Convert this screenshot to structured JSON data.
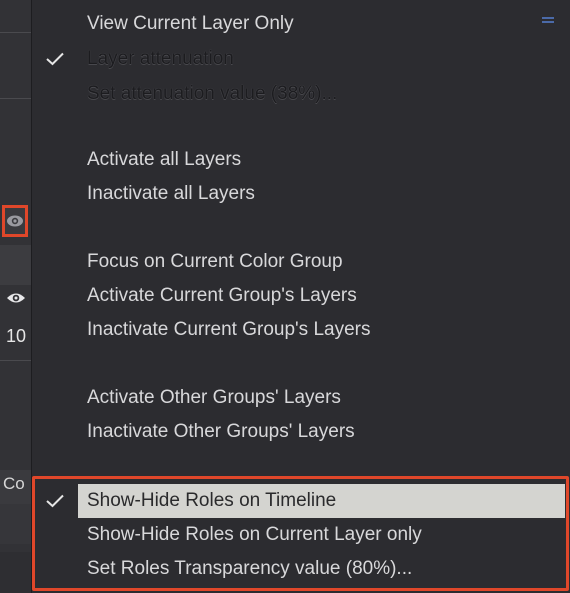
{
  "left_panel": {
    "number_text": "10",
    "co_text": "Co"
  },
  "menu": {
    "items": [
      {
        "label": "View Current Layer Only",
        "checked": false,
        "enabled": true
      },
      {
        "label": "Layer attenuation",
        "checked": true,
        "enabled": false
      },
      {
        "label": "Set attenuation value (38%)...",
        "checked": false,
        "enabled": false
      },
      {
        "label": "Activate all Layers",
        "checked": false,
        "enabled": true
      },
      {
        "label": "Inactivate all Layers",
        "checked": false,
        "enabled": true
      },
      {
        "label": "Focus on Current Color Group",
        "checked": false,
        "enabled": true
      },
      {
        "label": "Activate Current Group's Layers",
        "checked": false,
        "enabled": true
      },
      {
        "label": "Inactivate Current Group's Layers",
        "checked": false,
        "enabled": true
      },
      {
        "label": "Activate Other Groups' Layers",
        "checked": false,
        "enabled": true
      },
      {
        "label": "Inactivate Other Groups' Layers",
        "checked": false,
        "enabled": true
      },
      {
        "label": "Show-Hide Roles on Timeline",
        "checked": true,
        "enabled": true,
        "highlighted": true
      },
      {
        "label": "Show-Hide Roles on Current Layer only",
        "checked": false,
        "enabled": true
      },
      {
        "label": "Set Roles Transparency value (80%)...",
        "checked": false,
        "enabled": true
      }
    ]
  },
  "colors": {
    "annotation_red": "#e0472a",
    "menu_bg": "#2c2c30",
    "highlight_bg": "#d4d4d0",
    "accent_blue": "#4b6aa8"
  },
  "icons": {
    "checkmark": "checkmark-icon",
    "eye": "eye-icon",
    "menu": "hamburger-menu-icon"
  }
}
